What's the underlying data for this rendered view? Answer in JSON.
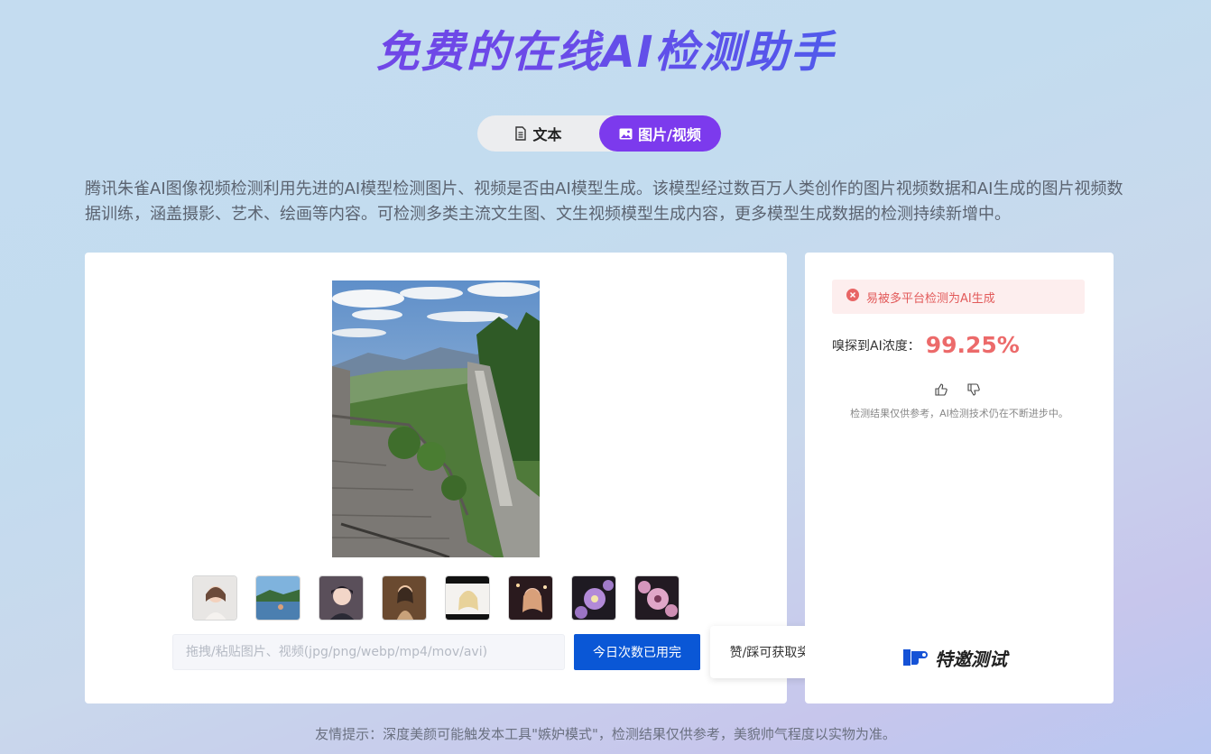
{
  "page": {
    "title": "免费的在线AI检测助手"
  },
  "mode_switch": {
    "tabs": [
      {
        "label": "文本",
        "icon": "document-icon",
        "active": false
      },
      {
        "label": "图片/视频",
        "icon": "image-icon",
        "active": true
      }
    ],
    "accent_color": "#7c3aed"
  },
  "description": "腾讯朱雀AI图像视频检测利用先进的AI模型检测图片、视频是否由AI模型生成。该模型经过数百万人类创作的图片视频数据和AI生成的图片视频数据训练，涵盖摄影、艺术、绘画等内容。可检测多类主流文生图、文生视频模型生成内容，更多模型生成数据的检测持续新增中。",
  "upload": {
    "placeholder": "拖拽/粘贴图片、视频(jpg/png/webp/mp4/mov/avi)",
    "button_label": "今日次数已用完",
    "button_color": "#0a57d6",
    "tooltip": "赞/踩可获取奖励次数"
  },
  "sample_thumbnails": [
    {
      "name": "portrait-woman"
    },
    {
      "name": "lake-landscape"
    },
    {
      "name": "anime-boy"
    },
    {
      "name": "fantasy-girl"
    },
    {
      "name": "blonde-woman"
    },
    {
      "name": "sparkle-portrait"
    },
    {
      "name": "purple-flowers"
    },
    {
      "name": "pink-flowers"
    }
  ],
  "result": {
    "alert_text": "易被多平台检测为AI生成",
    "alert_icon": "close-circle-icon",
    "score_label": "嗅探到AI浓度：",
    "score_value": "99.25%",
    "score_color": "#ec6a6a",
    "note": "检测结果仅供参考，AI检测技术仍在不断进步中。",
    "invite_label": "特邀测试"
  },
  "footer": {
    "tip": "友情提示：深度美颜可能触发本工具\"嫉妒模式\"，检测结果仅供参考，美貌帅气程度以实物为准。"
  }
}
